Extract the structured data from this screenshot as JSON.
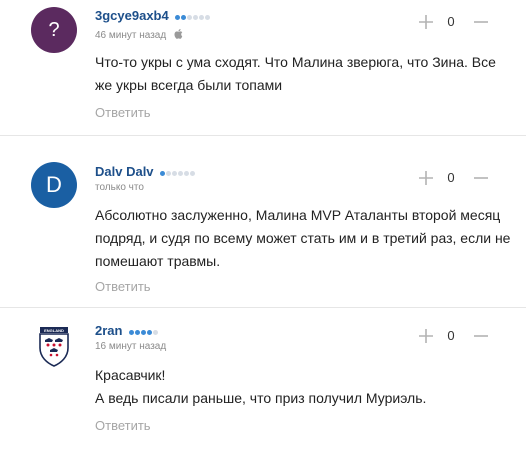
{
  "comments": [
    {
      "author": "3gcye9axb4",
      "time": "46 минут назад",
      "avatar_letter": "?",
      "avatar_color": "#5b2a5f",
      "rating_dots_on": 2,
      "rating_dots_total": 6,
      "device_icon": "apple-icon",
      "text": "Что-то укры с ума сходят. Что Малина зверюга, что Зина. Все же укры всегда были топами",
      "reply_label": "Ответить",
      "score": "0"
    },
    {
      "author": "Dalv Dalv",
      "time": "только что",
      "avatar_letter": "D",
      "avatar_color": "#1a5fa3",
      "rating_dots_on": 1,
      "rating_dots_total": 6,
      "text": "Абсолютно заслуженно, Малина MVP Аталанты второй месяц подряд, и судя по всему может стать им и в третий раз, если не помешают травмы.",
      "reply_label": "Ответить",
      "score": "0"
    },
    {
      "author": "2ran",
      "time": "16 минут назад",
      "avatar_icon": "england-crest-icon",
      "avatar_caption": "ENGLAND",
      "rating_dots_on": 4,
      "rating_dots_total": 5,
      "text_lines": [
        "Красавчик!",
        "А ведь писали раньше, что приз получил Муриэль."
      ],
      "reply_label": "Ответить",
      "score": "0"
    }
  ],
  "colors": {
    "author": "#1d4f8a",
    "dot_on": "#3b8bd6",
    "dot_off": "#d7dde5",
    "muted": "#a6a6a6"
  }
}
